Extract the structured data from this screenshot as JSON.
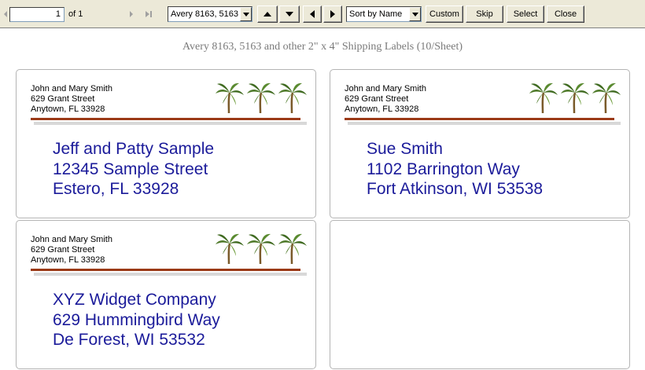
{
  "toolbar": {
    "page_value": "1",
    "page_of": "of 1",
    "label_format": "Avery 8163, 5163",
    "sort_option": "Sort by Name",
    "custom_label": "Custom",
    "skip_label": "Skip",
    "select_label": "Select",
    "close_label": "Close"
  },
  "sheet": {
    "title": "Avery  8163, 5163 and other 2\" x 4\" Shipping Labels (10/Sheet)"
  },
  "return_address": {
    "name": "John and Mary Smith",
    "street": "629 Grant Street",
    "city": "Anytown, FL 33928"
  },
  "labels": [
    {
      "line1": "Jeff and Patty Sample",
      "line2": "12345 Sample Street",
      "line3": "Estero, FL  33928"
    },
    {
      "line1": "Sue Smith",
      "line2": "1102 Barrington Way",
      "line3": "Fort Atkinson, WI  53538"
    },
    {
      "line1": "XYZ Widget Company",
      "line2": "629 Hummingbird Way",
      "line3": "De Forest, WI  53532"
    }
  ],
  "colors": {
    "address_text": "#1b1b9a",
    "rule_red": "#9b3a17",
    "toolbar_bg": "#ece9d8"
  },
  "icons": [
    "first-page-icon",
    "prev-page-icon",
    "next-page-icon",
    "last-page-icon",
    "dropdown-arrow-icon",
    "move-up-icon",
    "move-down-icon",
    "move-left-icon",
    "move-right-icon",
    "palm-tree-icon"
  ]
}
